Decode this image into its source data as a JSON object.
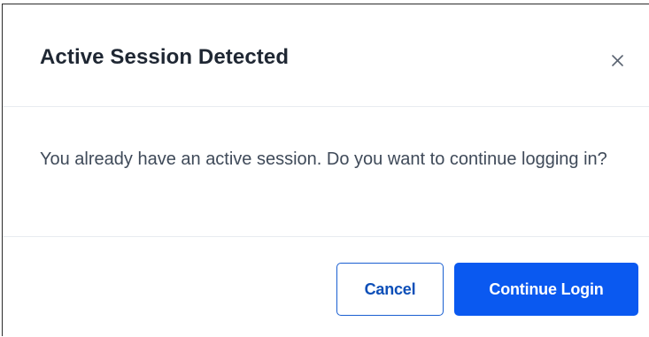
{
  "dialog": {
    "title": "Active Session Detected",
    "close_label": "×",
    "message": "You already have an active session. Do you want to continue logging in?",
    "buttons": {
      "cancel_label": "Cancel",
      "continue_label": "Continue Login"
    }
  },
  "colors": {
    "primary": "#0a59f0",
    "title_text": "#1f2733",
    "body_text": "#3f4a59",
    "divider": "#e8ebf0",
    "cancel_text": "#0d4fb8"
  },
  "icons": {
    "close": "close-icon"
  }
}
